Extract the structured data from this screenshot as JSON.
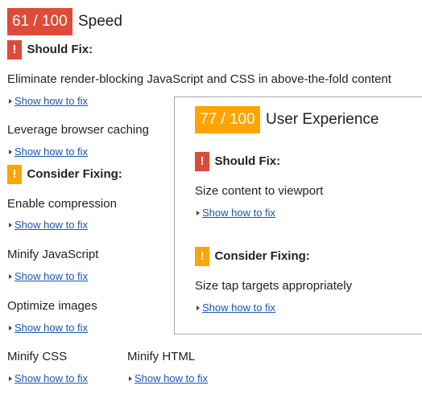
{
  "colors": {
    "red": "#dd4b39",
    "orange": "#ffa400",
    "link": "#1a55b4",
    "text": "#222222"
  },
  "speed": {
    "score": "61 / 100",
    "title": "Speed",
    "should_fix": "Should Fix:",
    "consider_fixing": "Consider Fixing:",
    "should_fix_rules": [
      "Eliminate render-blocking JavaScript and CSS in above-the-fold content",
      "Leverage browser caching"
    ],
    "consider_rules": [
      "Enable compression",
      "Minify JavaScript",
      "Optimize images",
      "Minify CSS",
      "Minify HTML"
    ]
  },
  "ux": {
    "score": "77 / 100",
    "title": "User Experience",
    "should_fix": "Should Fix:",
    "consider_fixing": "Consider Fixing:",
    "should_fix_rules": [
      "Size content to viewport"
    ],
    "consider_rules": [
      "Size tap targets appropriately"
    ]
  },
  "show_how_to_fix": "Show how to fix",
  "icons": {
    "alert": "exclamation-icon",
    "expand": "triangle-right-icon"
  }
}
